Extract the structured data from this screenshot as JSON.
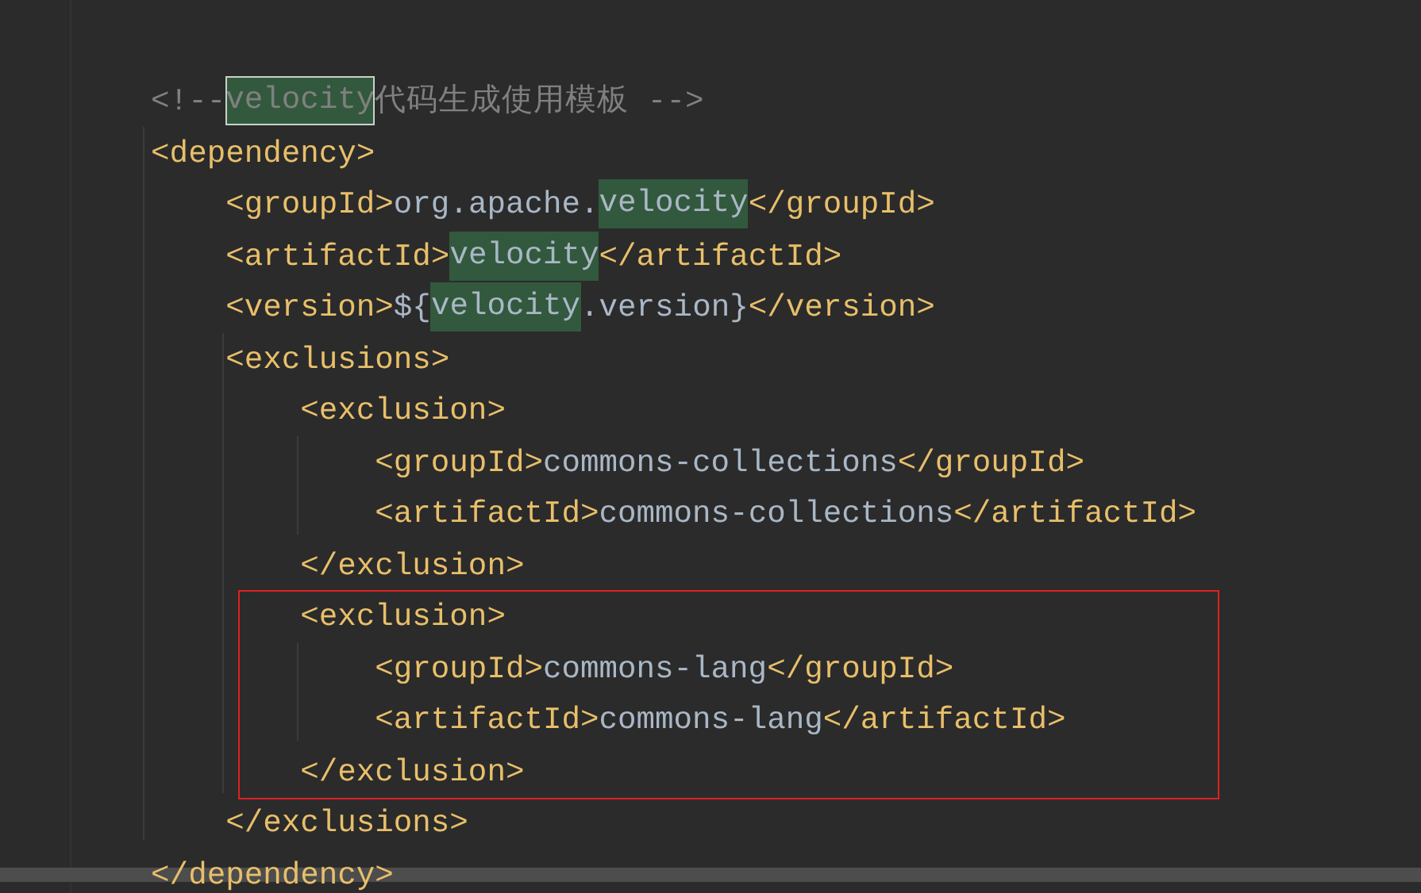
{
  "lines": [
    {
      "tokens": [
        {
          "kind": "comment",
          "text": "    <!--"
        },
        {
          "kind": "comment",
          "text": "velocity",
          "match": true,
          "selected": true
        },
        {
          "kind": "comment",
          "text": "代码生成使用模板 -->"
        }
      ]
    },
    {
      "tokens": [
        {
          "kind": "tag",
          "text": "    <dependency>"
        }
      ]
    },
    {
      "tokens": [
        {
          "kind": "tag",
          "text": "        <groupId>"
        },
        {
          "kind": "text",
          "text": "org.apache."
        },
        {
          "kind": "text",
          "text": "velocity",
          "match": true,
          "selected": false
        },
        {
          "kind": "tag",
          "text": "</groupId>"
        }
      ]
    },
    {
      "tokens": [
        {
          "kind": "tag",
          "text": "        <artifactId>"
        },
        {
          "kind": "text",
          "text": "velocity",
          "match": true,
          "selected": false
        },
        {
          "kind": "tag",
          "text": "</artifactId>"
        }
      ]
    },
    {
      "tokens": [
        {
          "kind": "tag",
          "text": "        <version>"
        },
        {
          "kind": "text",
          "text": "${"
        },
        {
          "kind": "text",
          "text": "velocity",
          "match": true,
          "selected": false
        },
        {
          "kind": "text",
          "text": ".version}"
        },
        {
          "kind": "tag",
          "text": "</version>"
        }
      ]
    },
    {
      "tokens": [
        {
          "kind": "tag",
          "text": "        <exclusions>"
        }
      ]
    },
    {
      "tokens": [
        {
          "kind": "tag",
          "text": "            <exclusion>"
        }
      ]
    },
    {
      "tokens": [
        {
          "kind": "tag",
          "text": "                <groupId>"
        },
        {
          "kind": "text",
          "text": "commons-collections"
        },
        {
          "kind": "tag",
          "text": "</groupId>"
        }
      ]
    },
    {
      "tokens": [
        {
          "kind": "tag",
          "text": "                <artifactId>"
        },
        {
          "kind": "text",
          "text": "commons-collections"
        },
        {
          "kind": "tag",
          "text": "</artifactId>"
        }
      ]
    },
    {
      "tokens": [
        {
          "kind": "tag",
          "text": "            </exclusion>"
        }
      ]
    },
    {
      "boxed": true,
      "tokens": [
        {
          "kind": "tag",
          "text": "            <exclusion>"
        }
      ]
    },
    {
      "boxed": true,
      "tokens": [
        {
          "kind": "tag",
          "text": "                <groupId>"
        },
        {
          "kind": "text",
          "text": "commons-lang"
        },
        {
          "kind": "tag",
          "text": "</groupId>"
        }
      ]
    },
    {
      "boxed": true,
      "tokens": [
        {
          "kind": "tag",
          "text": "                <artifactId>"
        },
        {
          "kind": "text",
          "text": "commons-lang"
        },
        {
          "kind": "tag",
          "text": "</artifactId>"
        }
      ]
    },
    {
      "boxed": true,
      "tokens": [
        {
          "kind": "tag",
          "text": "            </exclusion>"
        }
      ]
    },
    {
      "tokens": [
        {
          "kind": "tag",
          "text": "        </exclusions>"
        }
      ]
    },
    {
      "tokens": [
        {
          "kind": "tag",
          "text": "    </dependency>"
        }
      ]
    }
  ]
}
